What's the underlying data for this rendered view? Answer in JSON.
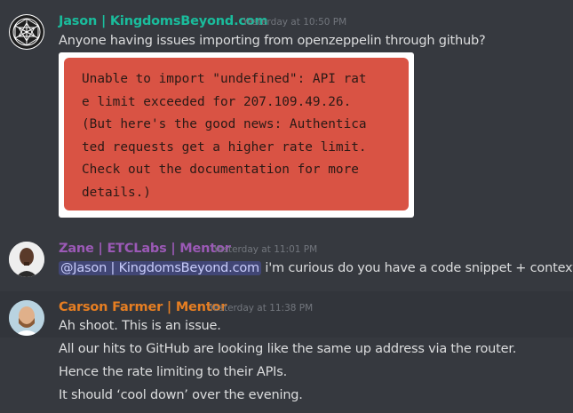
{
  "messages": [
    {
      "author": "Jason | KingdomsBeyond.com",
      "author_color": "#1abc9c",
      "timestamp": "Yesterday at 10:50 PM",
      "text": "Anyone having issues importing from openzeppelin through github?",
      "attachment_lines": [
        "Unable to import \"undefined\": API rat",
        "e limit exceeded for 207.109.49.26.",
        "(But here's the good news: Authentica",
        "ted requests get a higher rate limit.",
        "Check out the documentation for more",
        "details.)"
      ]
    },
    {
      "author": "Zane | ETCLabs | Mentor",
      "author_color": "#9b59b6",
      "timestamp": "Yesterday at 11:01 PM",
      "mention": "@Jason | KingdomsBeyond.com",
      "text": " i'm curious do you have a code snippet + context?"
    },
    {
      "author": "Carson Farmer | Mentor",
      "author_color": "#e67e22",
      "timestamp": "Yesterday at 11:38 PM",
      "lines": [
        "Ah shoot. This is an issue.",
        "All our hits to GitHub are looking like the same up address via the router.",
        "Hence the rate limiting to their APIs.",
        "It should ‘cool down’ over the evening."
      ]
    }
  ]
}
